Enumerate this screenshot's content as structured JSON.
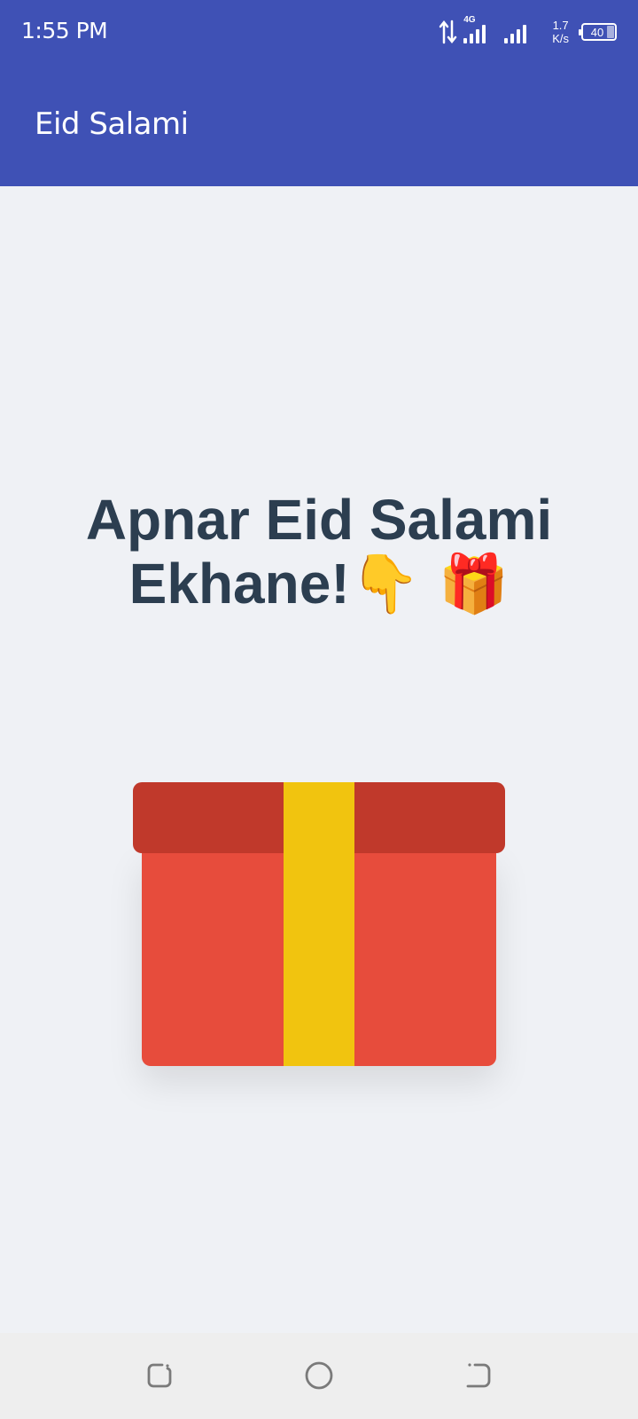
{
  "status_bar": {
    "time": "1:55 PM",
    "network_type": "4G",
    "speed_value": "1.7",
    "speed_unit": "K/s",
    "battery_level": "40",
    "icons": [
      "data-transfer-icon",
      "signal-icon",
      "signal-icon",
      "battery-icon"
    ]
  },
  "app_bar": {
    "title": "Eid Salami",
    "color": "#3f51b5"
  },
  "main": {
    "headline_line1": "Apnar Eid Salami",
    "headline_line2": "Ekhane!",
    "headline_emoji": "👇 🎁",
    "text_color": "#2c3e50",
    "background": "#eff1f5"
  },
  "gift_box": {
    "icon": "gift-box-icon",
    "body_color": "#e74c3c",
    "lid_color": "#c0392b",
    "ribbon_color": "#f1c40f"
  },
  "nav_bar": {
    "icons": [
      "recent-apps-icon",
      "home-icon",
      "back-icon"
    ]
  }
}
